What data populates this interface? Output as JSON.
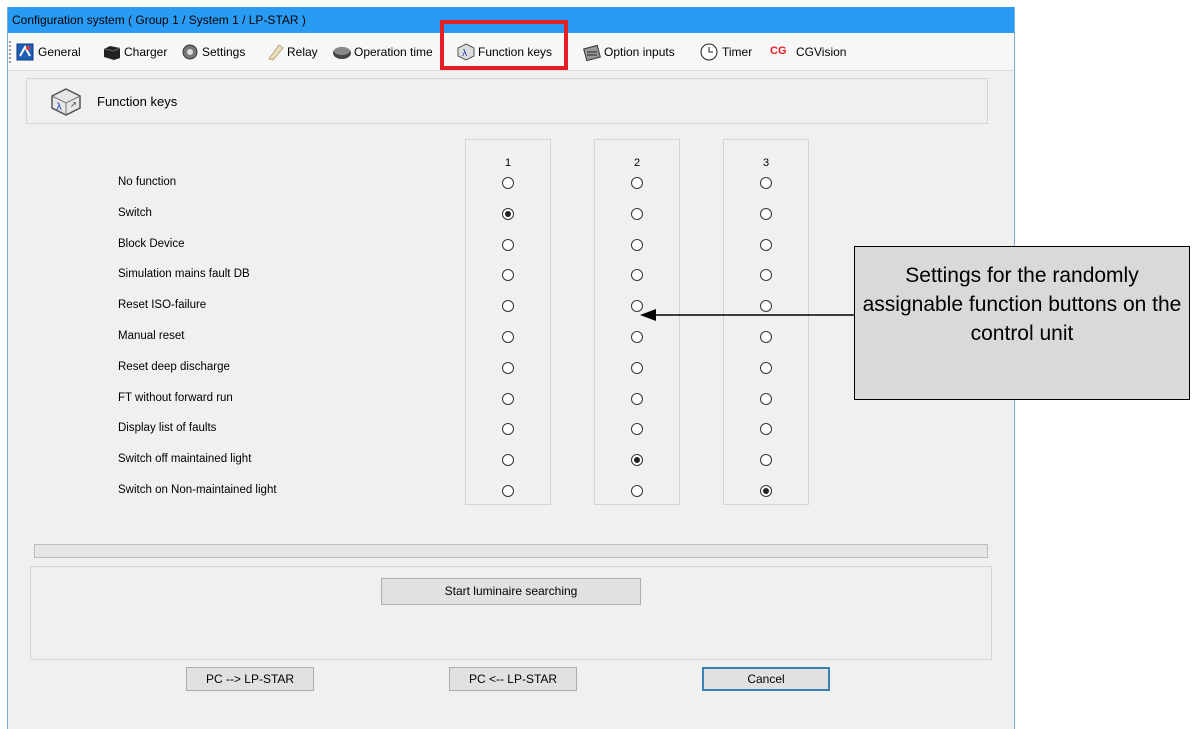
{
  "window": {
    "title": "Configuration system ( Group 1 / System 1 / LP-STAR )"
  },
  "toolbar": {
    "items": [
      {
        "label": "General",
        "icon": "general-icon"
      },
      {
        "label": "Charger",
        "icon": "charger-icon"
      },
      {
        "label": "Settings",
        "icon": "settings-gear-icon"
      },
      {
        "label": "Relay",
        "icon": "relay-icon"
      },
      {
        "label": "Operation time",
        "icon": "operation-time-icon"
      },
      {
        "label": "Function keys",
        "icon": "function-keys-icon"
      },
      {
        "label": "Option inputs",
        "icon": "option-inputs-icon"
      },
      {
        "label": "Timer",
        "icon": "clock-icon"
      },
      {
        "label": "CGVision",
        "icon": "cgvision-icon",
        "icon_text": "CG"
      }
    ]
  },
  "page": {
    "title": "Function keys"
  },
  "grid": {
    "columns": [
      "1",
      "2",
      "3"
    ],
    "rows": [
      {
        "label": "No function",
        "selected": [
          false,
          false,
          false
        ]
      },
      {
        "label": "Switch",
        "selected": [
          true,
          false,
          false
        ]
      },
      {
        "label": "Block Device",
        "selected": [
          false,
          false,
          false
        ]
      },
      {
        "label": "Simulation mains fault DB",
        "selected": [
          false,
          false,
          false
        ]
      },
      {
        "label": "Reset ISO-failure",
        "selected": [
          false,
          false,
          false
        ]
      },
      {
        "label": "Manual reset",
        "selected": [
          false,
          false,
          false
        ]
      },
      {
        "label": "Reset deep discharge",
        "selected": [
          false,
          false,
          false
        ]
      },
      {
        "label": "FT without forward run",
        "selected": [
          false,
          false,
          false
        ]
      },
      {
        "label": "Display list of faults",
        "selected": [
          false,
          false,
          false
        ]
      },
      {
        "label": "Switch off maintained light",
        "selected": [
          false,
          true,
          false
        ]
      },
      {
        "label": "Switch on Non-maintained light",
        "selected": [
          false,
          false,
          true
        ]
      }
    ]
  },
  "progress": {
    "value": 0
  },
  "buttons": {
    "search": "Start luminaire searching",
    "pc_to_device": "PC --> LP-STAR",
    "device_to_pc": "PC <-- LP-STAR",
    "cancel": "Cancel"
  },
  "annotation": {
    "text": "Settings for the randomly assignable function buttons on the control unit"
  },
  "colors": {
    "titlebar": "#2a9bf3",
    "highlight": "#e31e24",
    "callout_bg": "#d9d9d9"
  }
}
